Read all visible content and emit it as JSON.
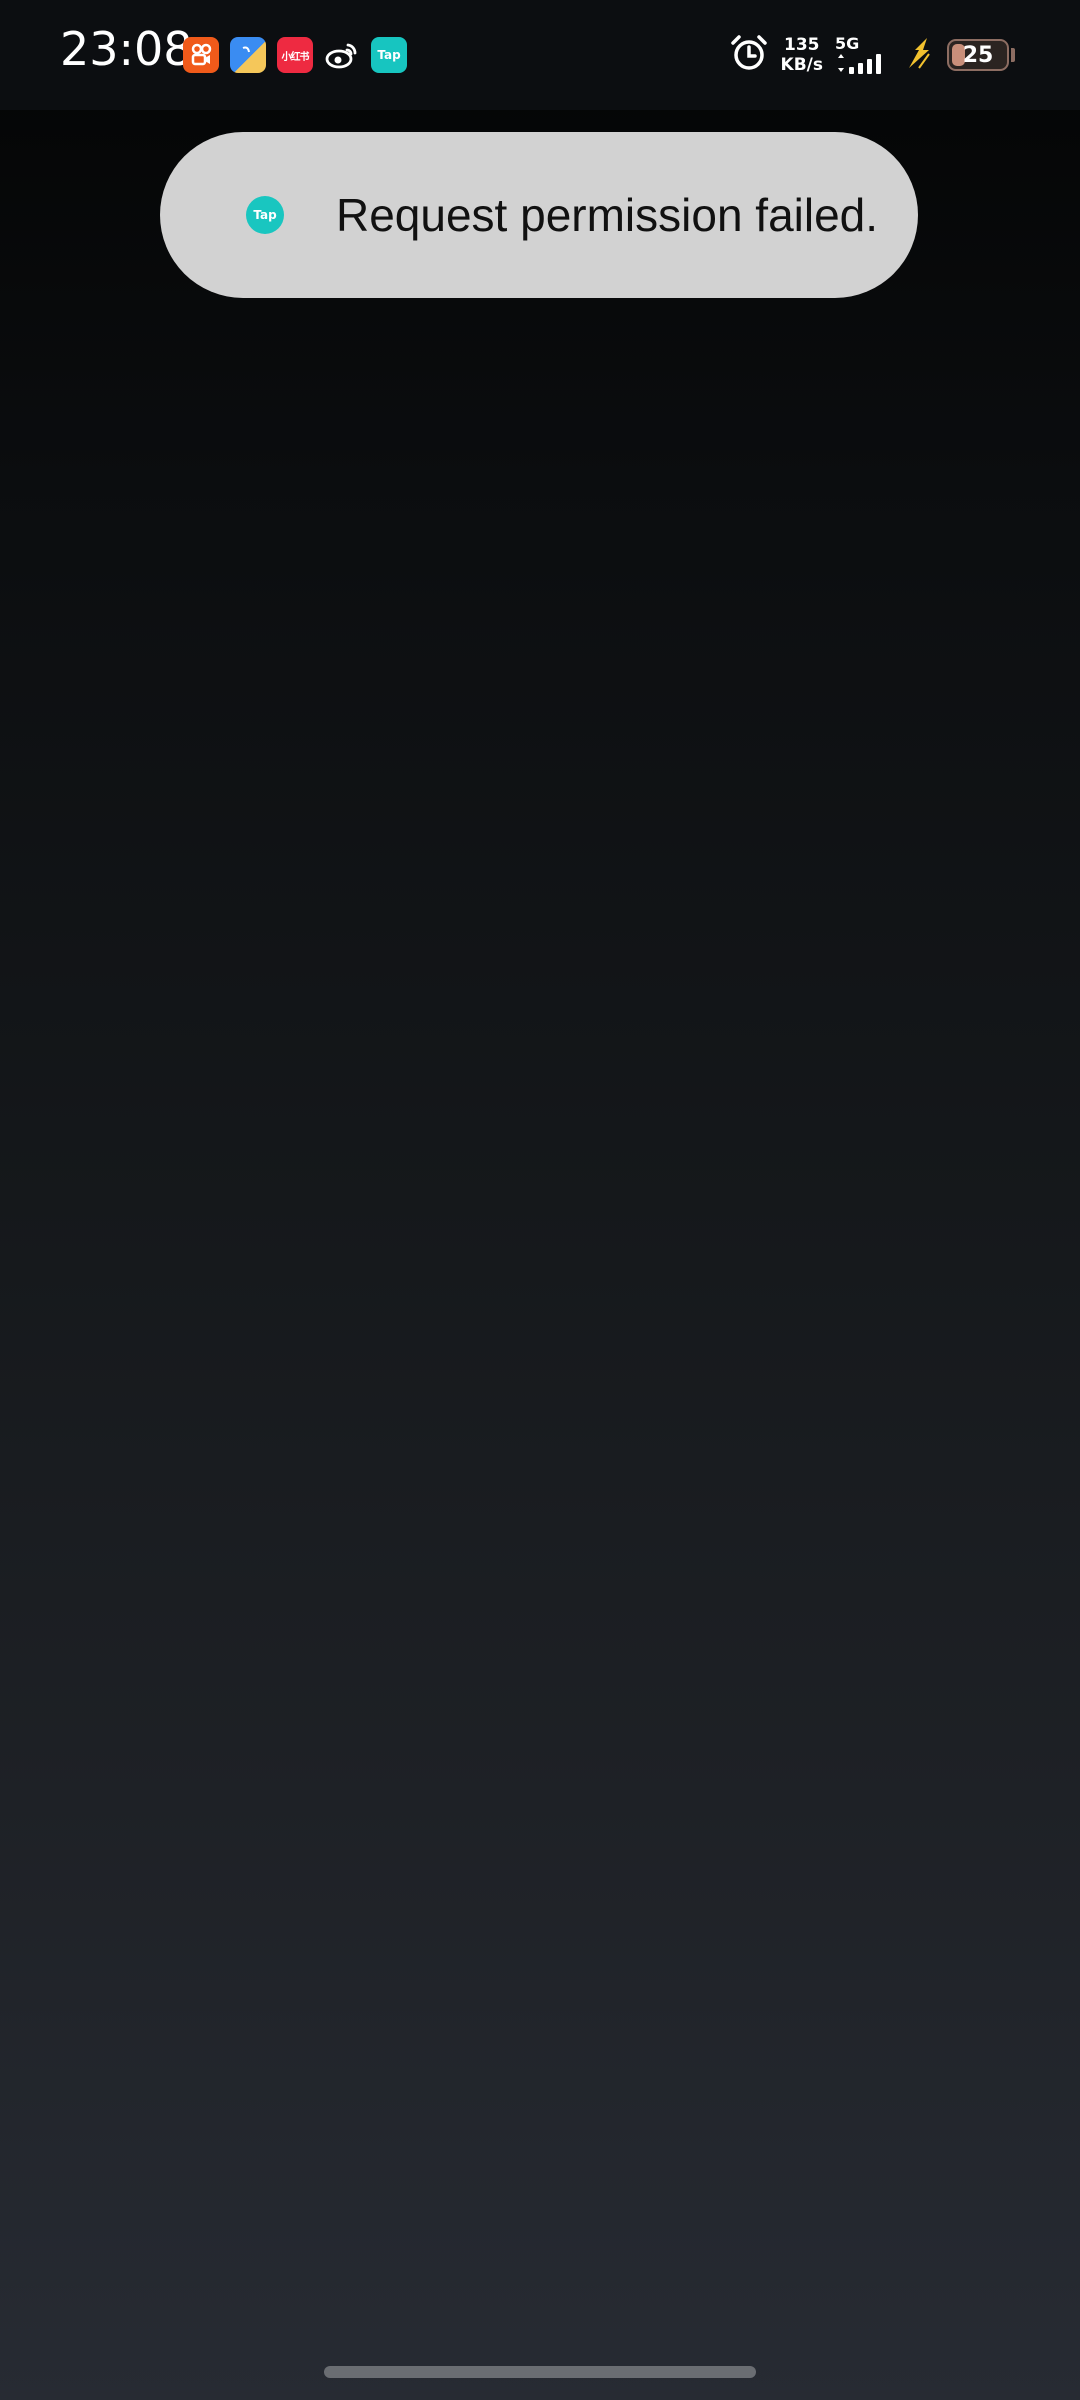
{
  "status_bar": {
    "time": "23:08",
    "notification_icons": [
      "kuaishou-icon",
      "files-icon",
      "xiaohongshu-icon",
      "weibo-icon",
      "taptap-icon"
    ],
    "xiaohongshu_label": "小红书",
    "tap_label": "Tap",
    "network_speed_value": "135",
    "network_speed_unit": "KB/s",
    "signal_type": "5G",
    "battery_level": "25",
    "battery_fraction": 0.25,
    "charging": true
  },
  "toast": {
    "icon_label": "Tap",
    "message": "Request permission failed."
  },
  "colors": {
    "toast_background": "#d2d2d2",
    "tap_accent": "#19c6c0",
    "charging_bolt": "#f2c12e"
  }
}
